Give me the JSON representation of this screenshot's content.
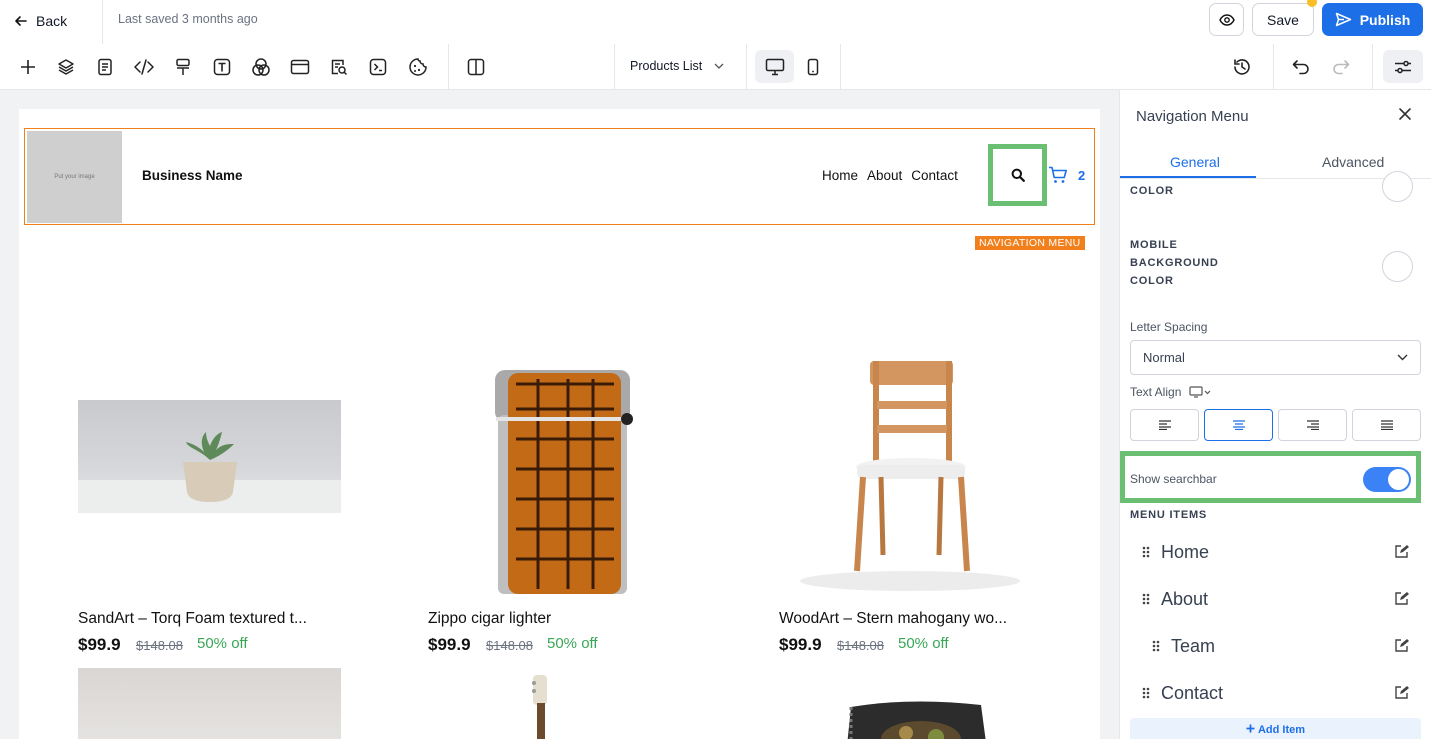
{
  "topbar": {
    "back_label": "Back",
    "saved_text": "Last saved 3 months ago",
    "save_label": "Save",
    "publish_label": "Publish"
  },
  "toolbar": {
    "tools": [
      "add-icon",
      "layers-icon",
      "pages-icon",
      "code-icon",
      "paint-roller-icon",
      "text-icon",
      "components-icon",
      "layout-icon",
      "seo-icon",
      "terminal-icon",
      "cookie-icon",
      "columns-icon"
    ],
    "page_select": "Products List",
    "device": "desktop"
  },
  "site": {
    "image_placeholder": "Put your image",
    "business_name": "Business Name",
    "nav_links": [
      "Home",
      "About",
      "Contact"
    ],
    "cart_count": "2",
    "selection_tag": "NAVIGATION MENU"
  },
  "products": [
    {
      "name": "SandArt – Torq Foam textured t...",
      "price": "$99.9",
      "old_price": "$148.08",
      "discount": "50% off"
    },
    {
      "name": "Zippo cigar lighter",
      "price": "$99.9",
      "old_price": "$148.08",
      "discount": "50% off"
    },
    {
      "name": "WoodArt – Stern mahogany wo...",
      "price": "$99.9",
      "old_price": "$148.08",
      "discount": "50% off"
    }
  ],
  "panel": {
    "title": "Navigation Menu",
    "tabs": [
      "General",
      "Advanced"
    ],
    "active_tab": "General",
    "color_label": "COLOR",
    "mobile_bg_label": [
      "MOBILE",
      "BACKGROUND",
      "COLOR"
    ],
    "letter_spacing_label": "Letter Spacing",
    "letter_spacing_value": "Normal",
    "text_align_label": "Text Align",
    "text_align_active": "center",
    "show_searchbar_label": "Show searchbar",
    "show_searchbar": true,
    "menu_items_label": "MENU ITEMS",
    "menu_items": [
      "Home",
      "About",
      "Team",
      "Contact"
    ],
    "add_item_label": "Add Item"
  },
  "colors": {
    "accent": "#1d6fe8",
    "selection": "#f07f1c",
    "highlight": "#6abf73",
    "discount": "#3aa757"
  }
}
